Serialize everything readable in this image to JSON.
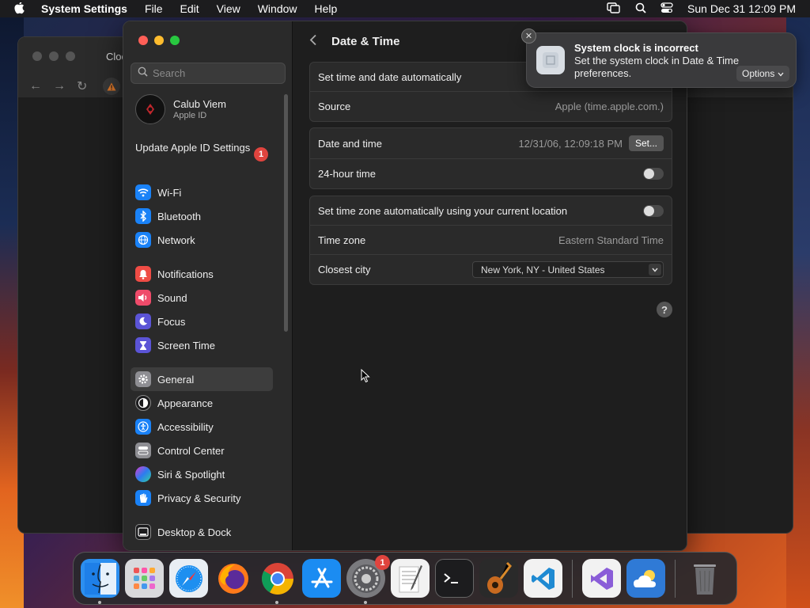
{
  "menubar": {
    "app_name": "System Settings",
    "menus": [
      "File",
      "Edit",
      "View",
      "Window",
      "Help"
    ],
    "datetime": "Sun Dec 31  12:09 PM"
  },
  "browser": {
    "tab_title": "Cloc"
  },
  "sidebar": {
    "search_placeholder": "Search",
    "account": {
      "name": "Calub Viem",
      "sub": "Apple ID"
    },
    "update": {
      "label": "Update Apple ID Settings",
      "badge": "1"
    },
    "groups": [
      [
        {
          "label": "Wi-Fi",
          "icon": "wifi-icon",
          "color": "#1a82f7"
        },
        {
          "label": "Bluetooth",
          "icon": "bluetooth-icon",
          "color": "#1a82f7"
        },
        {
          "label": "Network",
          "icon": "globe-icon",
          "color": "#1a82f7"
        }
      ],
      [
        {
          "label": "Notifications",
          "icon": "bell-icon",
          "color": "#ef4c45"
        },
        {
          "label": "Sound",
          "icon": "speaker-icon",
          "color": "#ef4b6a"
        },
        {
          "label": "Focus",
          "icon": "moon-icon",
          "color": "#5b54d6"
        },
        {
          "label": "Screen Time",
          "icon": "hourglass-icon",
          "color": "#5b54d6"
        }
      ],
      [
        {
          "label": "General",
          "icon": "gear-icon",
          "color": "#8e8e93",
          "selected": true
        },
        {
          "label": "Appearance",
          "icon": "appearance-icon",
          "color": "#1c1c1e"
        },
        {
          "label": "Accessibility",
          "icon": "accessibility-icon",
          "color": "#1a82f7"
        },
        {
          "label": "Control Center",
          "icon": "control-center-icon",
          "color": "#8e8e93"
        },
        {
          "label": "Siri & Spotlight",
          "icon": "siri-icon",
          "color": "#7a4fd6"
        },
        {
          "label": "Privacy & Security",
          "icon": "hand-icon",
          "color": "#1a82f7"
        }
      ],
      [
        {
          "label": "Desktop & Dock",
          "icon": "dock-icon",
          "color": "#1c1c1e"
        }
      ]
    ]
  },
  "content": {
    "title": "Date & Time",
    "group1": {
      "auto_label": "Set time and date automatically",
      "source_label": "Source",
      "source_value": "Apple (time.apple.com.)"
    },
    "group2": {
      "date_label": "Date and time",
      "date_value": "12/31/06, 12:09:18 PM",
      "set_button": "Set...",
      "hour24_label": "24-hour time"
    },
    "group3": {
      "tz_auto_label": "Set time zone automatically using your current location",
      "tz_label": "Time zone",
      "tz_value": "Eastern Standard Time",
      "city_label": "Closest city",
      "city_value": "New York, NY - United States"
    },
    "help": "?"
  },
  "notification": {
    "title": "System clock is incorrect",
    "body": "Set the system clock in Date & Time preferences.",
    "options": "Options"
  },
  "dock": {
    "apps": [
      {
        "name": "Finder",
        "color": "#2c8ff0",
        "running": true
      },
      {
        "name": "Launchpad",
        "color": "#d9d9dc",
        "running": false
      },
      {
        "name": "Safari",
        "color": "#e9eef4",
        "running": false
      },
      {
        "name": "Firefox",
        "color": "#3d2a80",
        "running": false
      },
      {
        "name": "Chrome",
        "color": "#f1f1f1",
        "running": true
      },
      {
        "name": "App Store",
        "color": "#1b8cf2",
        "running": false
      },
      {
        "name": "System Settings",
        "color": "#7a7a7e",
        "running": true,
        "badge": "1"
      },
      {
        "name": "TextEdit",
        "color": "#f2f2f2",
        "running": false
      },
      {
        "name": "Terminal",
        "color": "#1c1c1e",
        "running": false
      },
      {
        "name": "GarageBand",
        "color": "#2a2a2a",
        "running": false
      },
      {
        "name": "Visual Studio Code",
        "color": "#f2f2f2",
        "running": false
      },
      {
        "name": "Visual Studio",
        "color": "#f2f2f2",
        "running": false
      },
      {
        "name": "Weather",
        "color": "#2f7ad6",
        "running": false
      },
      {
        "name": "Trash",
        "color": "transparent",
        "running": false
      }
    ]
  }
}
